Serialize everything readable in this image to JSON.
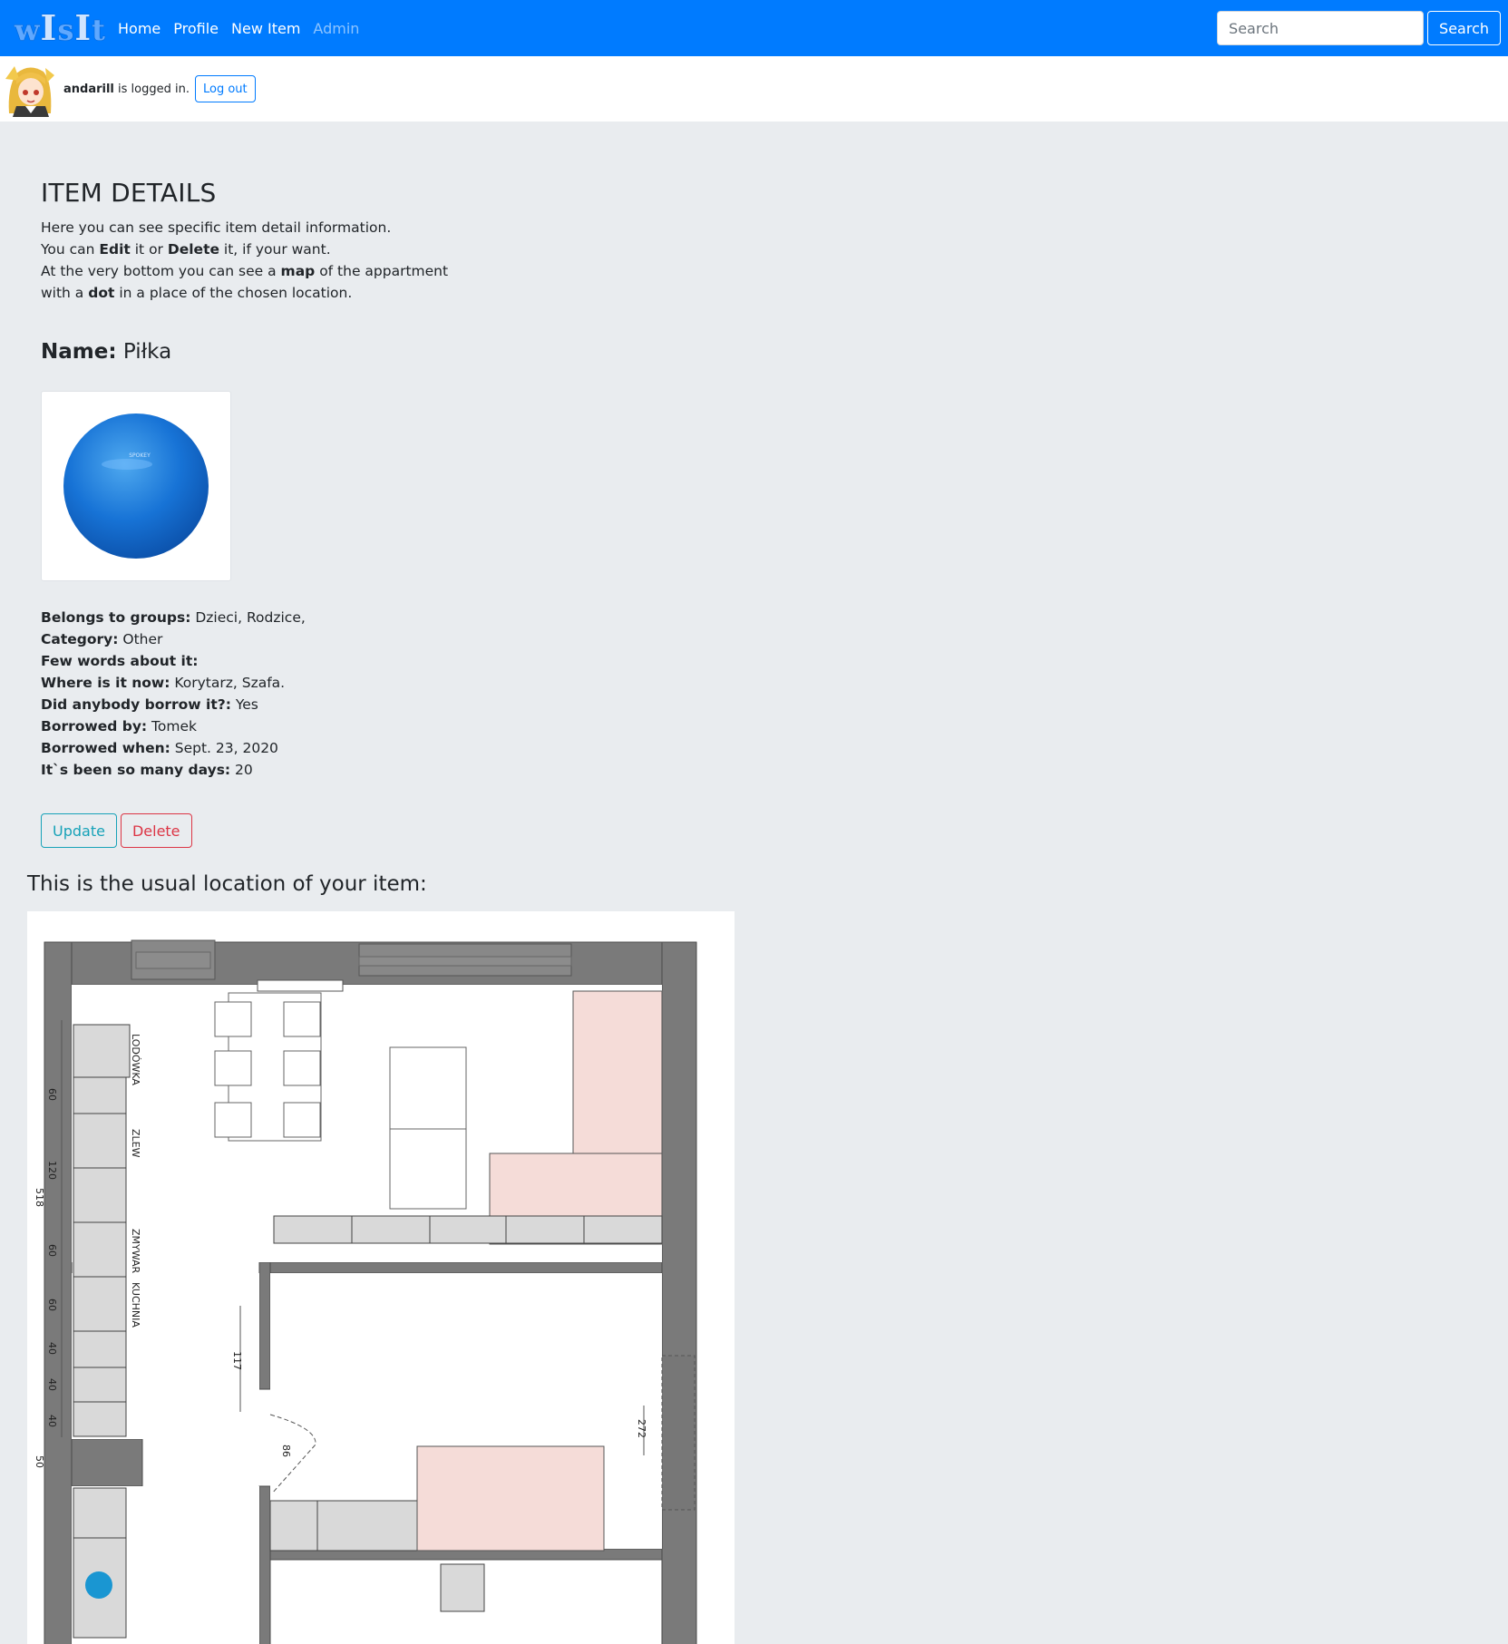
{
  "navbar": {
    "brand": "wIsIt",
    "links": [
      {
        "label": "Home",
        "disabled": false
      },
      {
        "label": "Profile",
        "disabled": false
      },
      {
        "label": "New Item",
        "disabled": false
      },
      {
        "label": "Admin",
        "disabled": true
      }
    ],
    "search_placeholder": "Search",
    "search_button": "Search",
    "color": "#007bff"
  },
  "user": {
    "username": "andarill",
    "status_text": " is logged in.",
    "logout_label": "Log out"
  },
  "page": {
    "title": "ITEM DETAILS",
    "intro": {
      "l1": "Here you can see specific item detail information.",
      "l2_a": "You can ",
      "l2_edit": "Edit",
      "l2_b": " it or ",
      "l2_delete": "Delete",
      "l2_c": " it, if your want.",
      "l3_a": "At the very bottom you can see a ",
      "l3_map": "map",
      "l3_b": " of the appartment",
      "l4_a": "with a ",
      "l4_dot": "dot",
      "l4_b": " in a place of the chosen location."
    },
    "name_label": "Name:",
    "name_value": " Piłka",
    "photo_brand": "SPOKEY"
  },
  "details": {
    "groups_label": "Belongs to groups:",
    "groups_value": " Dzieci, Rodzice,",
    "category_label": "Category:",
    "category_value": " Other",
    "words_label": "Few words about it:",
    "where_label": "Where is it now:",
    "where_value": " Korytarz, Szafa.",
    "borrow_label": "Did anybody borrow it?:",
    "borrow_value": " Yes",
    "by_label": "Borrowed by:",
    "by_value": " Tomek",
    "when_label": "Borrowed when:",
    "when_value": " Sept. 23, 2020",
    "days_label": "It`s been so many days:",
    "days_value": " 20"
  },
  "actions": {
    "update": "Update",
    "delete": "Delete"
  },
  "location": {
    "title": "This is the usual location of your item:",
    "map_labels": {
      "lodowka": "LODÓWKA",
      "zlew": "ZLEW",
      "zmywar": "ZMYWAR",
      "kuchnia": "KUCHNIA",
      "d60a": "60",
      "d120": "120",
      "d518": "518",
      "d60b": "60",
      "d60c": "60",
      "d40a": "40",
      "d40b": "40",
      "d40c": "40",
      "d50": "50",
      "d117": "117",
      "d86": "86",
      "d272": "272"
    },
    "dot_color": "#1a96d2"
  }
}
